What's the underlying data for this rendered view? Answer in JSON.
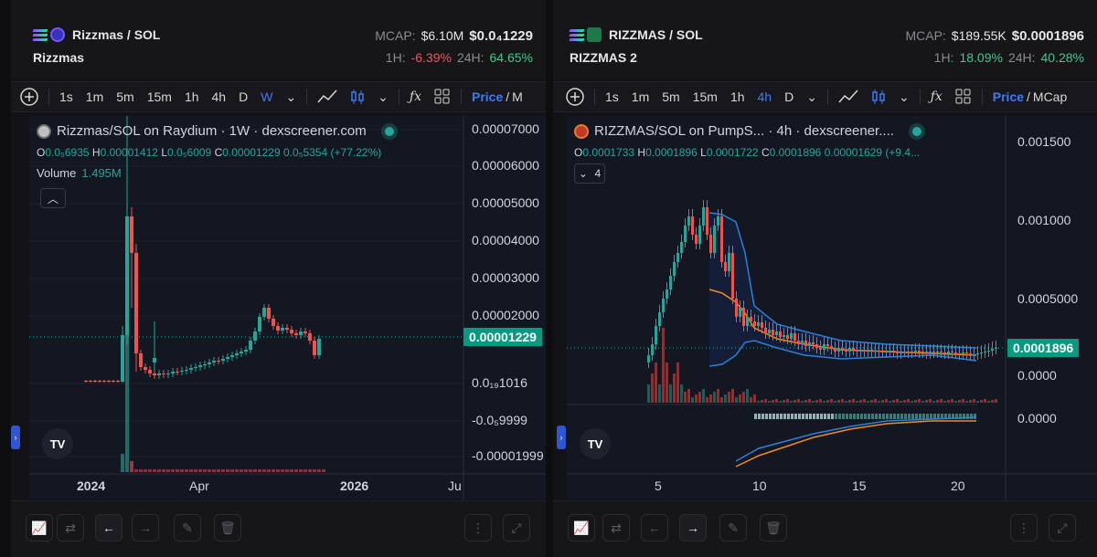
{
  "left": {
    "pair": "Rizzmas / SOL",
    "name": "Rizzmas",
    "mcap_label": "MCAP:",
    "mcap": "$6.10M",
    "price": "$0.0₄1229",
    "h1_label": "1H:",
    "h1": "-6.39%",
    "h24_label": "24H:",
    "h24": "64.65%",
    "timeframes": [
      "1s",
      "1m",
      "5m",
      "15m",
      "1h",
      "4h",
      "D",
      "W"
    ],
    "active_tf": "W",
    "price_label": "Price",
    "slash": "/",
    "mcap_toggle": "M",
    "legend_title": "Rizzmas/SOL on Raydium · 1W · dexscreener.com",
    "ohlc": {
      "O": "0.0₅6935",
      "H": "0.00001412",
      "L": "0.0₅6009",
      "C": "0.00001229",
      "change": "0.0₅5354 (+77.22%)"
    },
    "volume_label": "Volume",
    "volume": "1.495M",
    "y_ticks": [
      "0.00007000",
      "0.00006000",
      "0.00005000",
      "0.00004000",
      "0.00003000",
      "0.00002000",
      "0.0₁₉1016",
      "-0.0₅9999",
      "-0.00001999"
    ],
    "current_price": "0.00001229",
    "x_ticks": [
      "2024",
      "Apr",
      "2026",
      "Ju"
    ]
  },
  "right": {
    "pair": "RIZZMAS / SOL",
    "name": "RIZZMAS 2",
    "mcap_label": "MCAP:",
    "mcap": "$189.55K",
    "price": "$0.0001896",
    "h1_label": "1H:",
    "h1": "18.09%",
    "h24_label": "24H:",
    "h24": "40.28%",
    "timeframes": [
      "1s",
      "1m",
      "5m",
      "15m",
      "1h",
      "4h",
      "D"
    ],
    "active_tf": "4h",
    "price_label": "Price",
    "slash": "/",
    "mcap_toggle": "MCap",
    "legend_title": "RIZZMAS/SOL on PumpS...   · 4h · dexscreener....",
    "ohlc": {
      "O": "0.0001733",
      "H": "0.0001896",
      "L": "0.0001722",
      "C": "0.0001896",
      "change": "0.00001629 (+9.4..."
    },
    "indicator_count": "4",
    "y_ticks": [
      "0.001500",
      "0.001000",
      "0.0005000",
      "0.0000",
      "0.0000"
    ],
    "current_price": "0.0001896",
    "x_ticks": [
      "5",
      "10",
      "15",
      "20"
    ]
  },
  "colors": {
    "up": "#26a69a",
    "down": "#ef5350",
    "accent": "#3d7bf5",
    "bb": "#2f7fd6",
    "ma": "#f08a24"
  }
}
